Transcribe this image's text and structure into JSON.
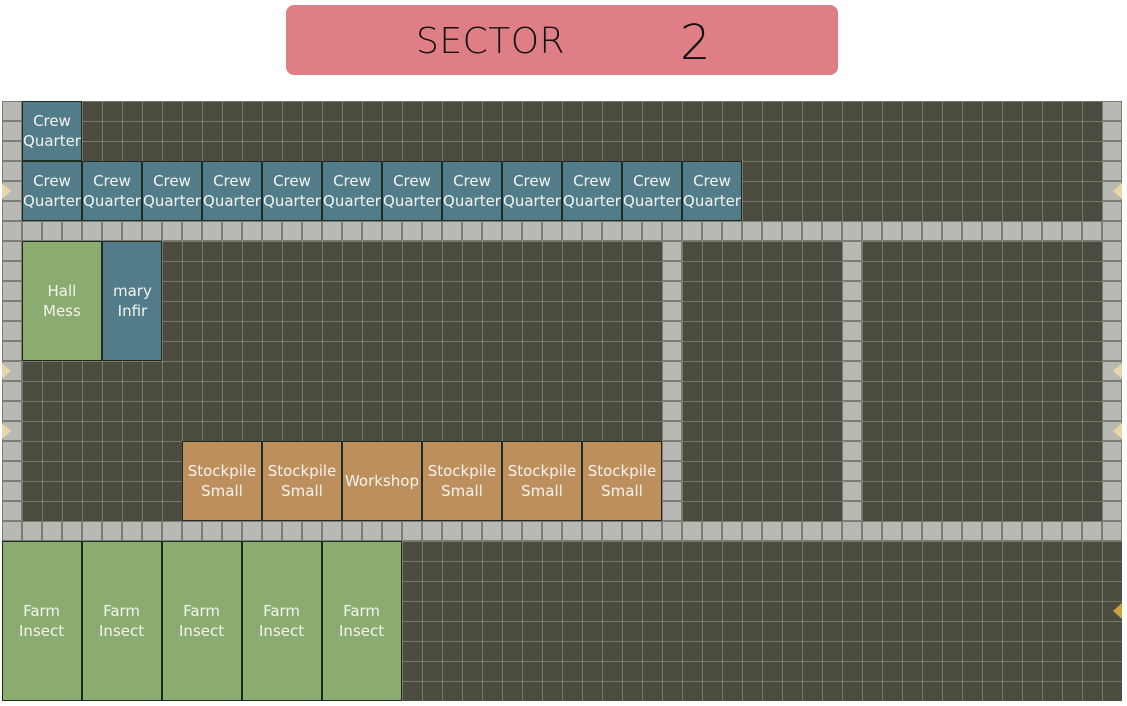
{
  "header": {
    "label": "SECTOR",
    "sector_number": "2",
    "background_color": "#e07e86"
  },
  "map": {
    "floor_color": "#4c4b3f",
    "corridor_color": "#b9b9b3",
    "rooms": [
      {
        "name": "Crew Quarter",
        "lines": [
          "Crew",
          "Quarter"
        ],
        "type": "crew-quarter",
        "color": "#527c8a"
      },
      {
        "name": "Crew Quarter",
        "lines": [
          "Crew",
          "Quarter"
        ],
        "type": "crew-quarter",
        "color": "#527c8a"
      },
      {
        "name": "Crew Quarter",
        "lines": [
          "Crew",
          "Quarter"
        ],
        "type": "crew-quarter",
        "color": "#527c8a"
      },
      {
        "name": "Crew Quarter",
        "lines": [
          "Crew",
          "Quarter"
        ],
        "type": "crew-quarter",
        "color": "#527c8a"
      },
      {
        "name": "Crew Quarter",
        "lines": [
          "Crew",
          "Quarter"
        ],
        "type": "crew-quarter",
        "color": "#527c8a"
      },
      {
        "name": "Crew Quarter",
        "lines": [
          "Crew",
          "Quarter"
        ],
        "type": "crew-quarter",
        "color": "#527c8a"
      },
      {
        "name": "Crew Quarter",
        "lines": [
          "Crew",
          "Quarter"
        ],
        "type": "crew-quarter",
        "color": "#527c8a"
      },
      {
        "name": "Crew Quarter",
        "lines": [
          "Crew",
          "Quarter"
        ],
        "type": "crew-quarter",
        "color": "#527c8a"
      },
      {
        "name": "Crew Quarter",
        "lines": [
          "Crew",
          "Quarter"
        ],
        "type": "crew-quarter",
        "color": "#527c8a"
      },
      {
        "name": "Crew Quarter",
        "lines": [
          "Crew",
          "Quarter"
        ],
        "type": "crew-quarter",
        "color": "#527c8a"
      },
      {
        "name": "Crew Quarter",
        "lines": [
          "Crew",
          "Quarter"
        ],
        "type": "crew-quarter",
        "color": "#527c8a"
      },
      {
        "name": "Crew Quarter",
        "lines": [
          "Crew",
          "Quarter"
        ],
        "type": "crew-quarter",
        "color": "#527c8a"
      },
      {
        "name": "Crew Quarter",
        "lines": [
          "Crew",
          "Quarter"
        ],
        "type": "crew-quarter",
        "color": "#527c8a"
      },
      {
        "name": "Mess Hall",
        "lines": [
          "Mess",
          "Hall"
        ],
        "type": "mess-hall",
        "color": "#8aac70",
        "upside_down": true
      },
      {
        "name": "Infirmary",
        "lines": [
          "Infir",
          "mary"
        ],
        "type": "infirmary",
        "color": "#527c8a",
        "upside_down": true
      },
      {
        "name": "Stockpile Small",
        "lines": [
          "Stockpile",
          "Small"
        ],
        "type": "stockpile-small",
        "color": "#bd8f5c"
      },
      {
        "name": "Stockpile Small",
        "lines": [
          "Stockpile",
          "Small"
        ],
        "type": "stockpile-small",
        "color": "#bd8f5c"
      },
      {
        "name": "Workshop",
        "lines": [
          "Workshop"
        ],
        "type": "workshop",
        "color": "#bd8f5c"
      },
      {
        "name": "Stockpile Small",
        "lines": [
          "Stockpile",
          "Small"
        ],
        "type": "stockpile-small",
        "color": "#bd8f5c"
      },
      {
        "name": "Stockpile Small",
        "lines": [
          "Stockpile",
          "Small"
        ],
        "type": "stockpile-small",
        "color": "#bd8f5c"
      },
      {
        "name": "Stockpile Small",
        "lines": [
          "Stockpile",
          "Small"
        ],
        "type": "stockpile-small",
        "color": "#bd8f5c"
      },
      {
        "name": "Insect Farm",
        "lines": [
          "Insect",
          "Farm"
        ],
        "type": "insect-farm",
        "color": "#8aac70",
        "upside_down": true
      },
      {
        "name": "Insect Farm",
        "lines": [
          "Insect",
          "Farm"
        ],
        "type": "insect-farm",
        "color": "#8aac70",
        "upside_down": true
      },
      {
        "name": "Insect Farm",
        "lines": [
          "Insect",
          "Farm"
        ],
        "type": "insect-farm",
        "color": "#8aac70",
        "upside_down": true
      },
      {
        "name": "Insect Farm",
        "lines": [
          "Insect",
          "Farm"
        ],
        "type": "insect-farm",
        "color": "#8aac70",
        "upside_down": true
      },
      {
        "name": "Insect Farm",
        "lines": [
          "Insect",
          "Farm"
        ],
        "type": "insect-farm",
        "color": "#8aac70",
        "upside_down": true
      }
    ],
    "doors": [
      {
        "side": "left",
        "type": "entrance"
      },
      {
        "side": "left",
        "type": "entrance"
      },
      {
        "side": "left",
        "type": "entrance"
      },
      {
        "side": "right",
        "type": "entrance"
      },
      {
        "side": "right",
        "type": "entrance"
      },
      {
        "side": "right",
        "type": "entrance"
      },
      {
        "side": "right",
        "type": "entrance-highlighted"
      }
    ]
  }
}
